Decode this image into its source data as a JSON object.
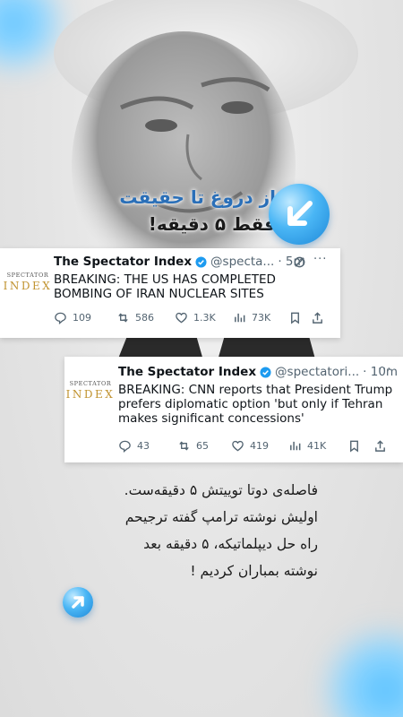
{
  "headline": {
    "line1": "از دروغ تا حقیقت",
    "line2": "فقط ۵ دقیقه!"
  },
  "tweets": [
    {
      "logo_top": "SPECTATOR",
      "logo_bottom": "INDEX",
      "name": "The Spectator Index",
      "handle": "@specta...",
      "time": "· 5m",
      "text_lines": [
        "BREAKING: THE US HAS COMPLETED",
        "BOMBING OF IRAN NUCLEAR SITES"
      ],
      "replies": "109",
      "retweets": "586",
      "likes": "1.3K",
      "views": "73K"
    },
    {
      "logo_top": "SPECTATOR",
      "logo_bottom": "INDEX",
      "name": "The Spectator Index",
      "handle": "@spectatori...",
      "time": "· 10m",
      "text_lines": [
        "BREAKING: CNN reports that President Trump",
        "prefers diplomatic option 'but only if Tehran",
        "makes significant concessions'"
      ],
      "replies": "43",
      "retweets": "65",
      "likes": "419",
      "views": "41K"
    }
  ],
  "note_lines": [
    "فاصله‌ی دوتا توییتش ۵ دقیقه‌ست.",
    "اولیش نوشته ترامپ گفته ترجیحم",
    "راه حل دیپلماتیکه، ۵ دقیقه بعد",
    "نوشته بمباران کردیم !"
  ],
  "colors": {
    "accent": "#2a6fb8",
    "bubble": "#3aa9ef",
    "verified": "#1d9bf0"
  },
  "icons": [
    "arrow-down-left-icon",
    "arrow-up-right-icon",
    "verified-badge-icon",
    "grok-icon",
    "more-icon",
    "reply-icon",
    "retweet-icon",
    "like-icon",
    "views-icon",
    "bookmark-icon",
    "share-icon"
  ]
}
